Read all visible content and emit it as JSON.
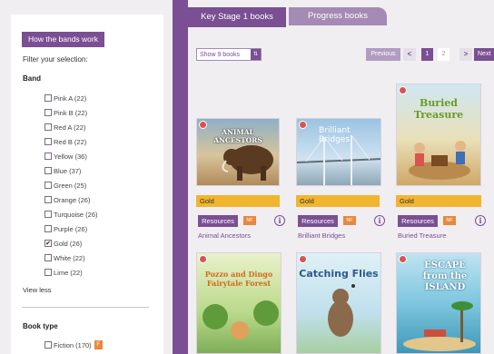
{
  "sidebar": {
    "bands_button": "How the bands work",
    "filter_label": "Filter your selection:",
    "band_heading": "Band",
    "bands": [
      {
        "label": "Pink A (22)",
        "checked": false
      },
      {
        "label": "Pink B (22)",
        "checked": false
      },
      {
        "label": "Red A (22)",
        "checked": false
      },
      {
        "label": "Red B (22)",
        "checked": false
      },
      {
        "label": "Yellow (36)",
        "checked": false
      },
      {
        "label": "Blue (37)",
        "checked": false
      },
      {
        "label": "Green (25)",
        "checked": false
      },
      {
        "label": "Orange (26)",
        "checked": false
      },
      {
        "label": "Turquoise (26)",
        "checked": false
      },
      {
        "label": "Purple (26)",
        "checked": false
      },
      {
        "label": "Gold (26)",
        "checked": true
      },
      {
        "label": "White (22)",
        "checked": false
      },
      {
        "label": "Lime (22)",
        "checked": false
      }
    ],
    "view_less": "View less",
    "book_type_heading": "Book type",
    "fiction_label": "Fiction (170)",
    "fiction_badge": "F"
  },
  "tabs": {
    "active": "Key Stage 1 books",
    "inactive": "Progress books"
  },
  "toolbar": {
    "show_select": "Show 9 books",
    "previous": "Previous",
    "prev_arrow": "<",
    "pages": [
      "1",
      "2"
    ],
    "next_arrow": ">",
    "next": "Next"
  },
  "books": [
    {
      "title": "Animal Ancestors",
      "cover_title": "ANIMAL ANCESTORS",
      "level": "Gold",
      "resources": "Resources",
      "badge": "NF",
      "info": "i"
    },
    {
      "title": "Brilliant Bridges",
      "cover_title": "Brilliant Bridges",
      "level": "Gold",
      "resources": "Resources",
      "badge": "NF",
      "info": "i"
    },
    {
      "title": "Buried Treasure",
      "cover_title": "Buried Treasure",
      "level": "Gold",
      "resources": "Resources",
      "badge": "NF",
      "info": "i"
    },
    {
      "title": "",
      "cover_title": "Pozzo and Dingo Fairytale Forest",
      "level": "",
      "resources": "",
      "badge": "",
      "info": ""
    },
    {
      "title": "",
      "cover_title": "Catching Flies",
      "level": "",
      "resources": "",
      "badge": "",
      "info": ""
    },
    {
      "title": "",
      "cover_title": "ESCAPE from the ISLAND",
      "level": "",
      "resources": "",
      "badge": "",
      "info": ""
    }
  ],
  "colors": {
    "purple": "#7a4f93",
    "gold": "#f1b52e",
    "orange_badge": "#e8883e"
  }
}
